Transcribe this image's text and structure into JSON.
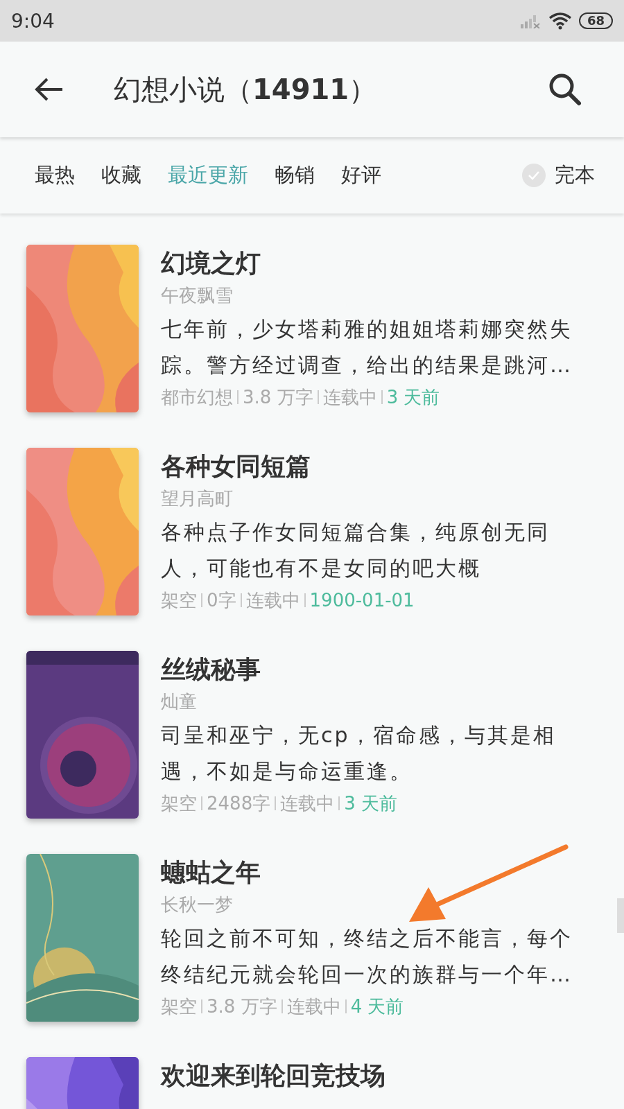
{
  "status_bar": {
    "time": "9:04",
    "battery": "68"
  },
  "header": {
    "title": "幻想小说（**14911**）"
  },
  "tabs": [
    {
      "label": "最热",
      "selected": false
    },
    {
      "label": "收藏",
      "selected": false
    },
    {
      "label": "最近更新",
      "selected": true
    },
    {
      "label": "畅销",
      "selected": false
    },
    {
      "label": "好评",
      "selected": false
    }
  ],
  "finished_filter": {
    "label": "完本",
    "checked": false
  },
  "books": [
    {
      "title": "幻境之灯",
      "author": "午夜飘雪",
      "description": "七年前，少女塔莉雅的姐姐塔莉娜突然失踪。警方经过调查，给出的结果是跳河…",
      "genre": "都市幻想",
      "words": "3.8 万字",
      "status": "连载中",
      "updated": "3 天前"
    },
    {
      "title": "各种女同短篇",
      "author": "望月高町",
      "description": "各种点子作女同短篇合集，纯原创无同人，可能也有不是女同的吧大概",
      "genre": "架空",
      "words": "0字",
      "status": "连载中",
      "updated": "1900-01-01"
    },
    {
      "title": "丝绒秘事",
      "author": "灿童",
      "description": "司呈和巫宁，无cp，宿命感，与其是相遇，不如是与命运重逢。",
      "genre": "架空",
      "words": "2488字",
      "status": "连载中",
      "updated": "3 天前"
    },
    {
      "title": "蟪蛄之年",
      "author": "长秋一梦",
      "description": "轮回之前不可知，终结之后不能言，每个终结纪元就会轮回一次的族群与一个年…",
      "genre": "架空",
      "words": "3.8 万字",
      "status": "连载中",
      "updated": "4 天前"
    },
    {
      "title": "欢迎来到轮回竞技场"
    }
  ]
}
